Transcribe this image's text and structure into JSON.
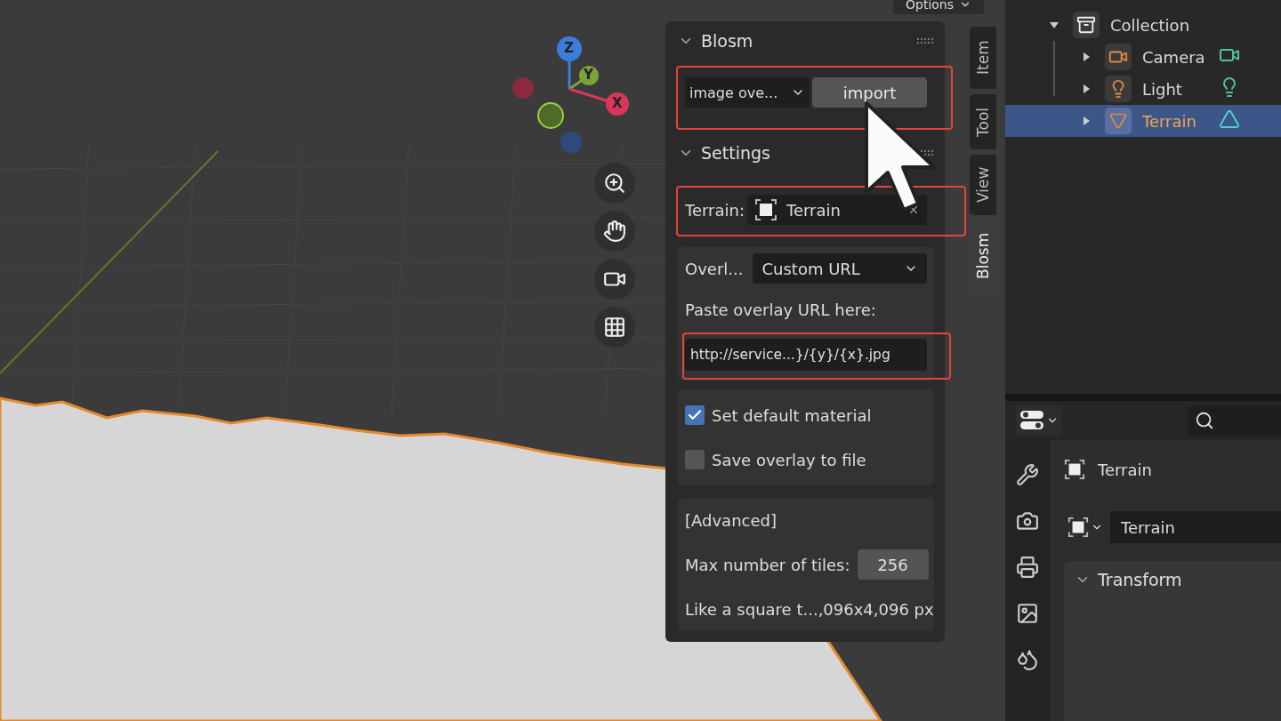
{
  "viewport": {
    "options_button": "Options",
    "axes": [
      {
        "label": "Z"
      },
      {
        "label": "Y"
      },
      {
        "label": "X"
      }
    ]
  },
  "sidebar": {
    "tabs": [
      {
        "label": "Item",
        "selected": false
      },
      {
        "label": "Tool",
        "selected": false
      },
      {
        "label": "View",
        "selected": false
      },
      {
        "label": "Blosm",
        "selected": true
      }
    ],
    "blosm_panel": {
      "title": "Blosm",
      "expanded": true,
      "mode_dropdown": "image ove...",
      "import_button": "import"
    },
    "settings_panel": {
      "title": "Settings",
      "expanded": true,
      "terrain_label": "Terrain:",
      "terrain_value": "Terrain",
      "overlay_label": "Overl...",
      "overlay_value": "Custom URL",
      "url_label": "Paste overlay URL here:",
      "url_value": "http://service...}/{y}/{x}.jpg",
      "options": [
        {
          "label": "Set default material",
          "checked": true
        },
        {
          "label": "Save overlay to file",
          "checked": false
        }
      ],
      "advanced_label": "[Advanced]",
      "max_tiles_label": "Max number of tiles:",
      "max_tiles_value": "256",
      "note": "Like a square t...,096x4,096 px"
    }
  },
  "outliner": {
    "items": [
      {
        "label": "Collection",
        "kind": "collection",
        "expanded": true,
        "selected": false,
        "children": [
          {
            "label": "Camera",
            "kind": "camera",
            "expanded": false,
            "selected": false
          },
          {
            "label": "Light",
            "kind": "light",
            "expanded": false,
            "selected": false
          },
          {
            "label": "Terrain",
            "kind": "mesh",
            "expanded": false,
            "selected": true
          }
        ]
      }
    ]
  },
  "properties": {
    "object_name": "Terrain",
    "data_name": "Terrain",
    "panels": [
      {
        "title": "Transform",
        "expanded": true
      }
    ]
  }
}
